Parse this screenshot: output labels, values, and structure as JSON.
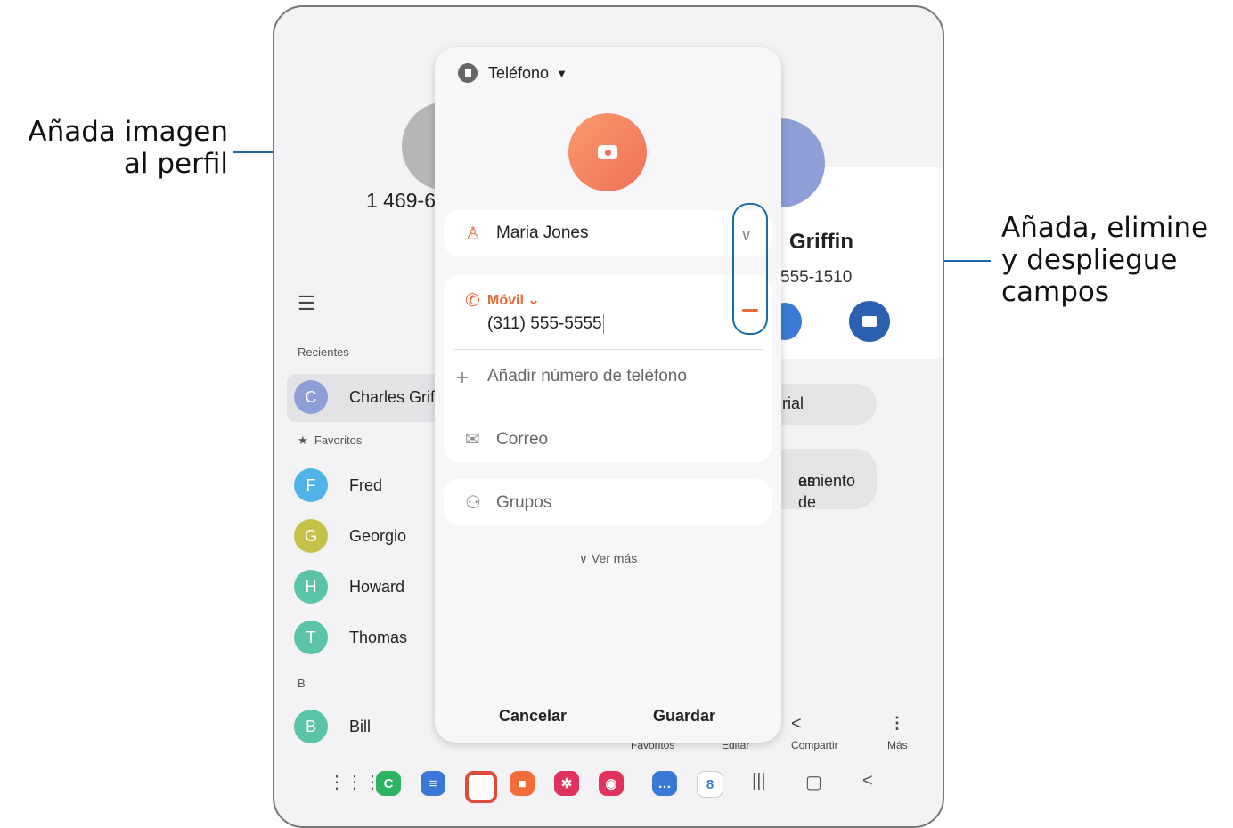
{
  "callouts": {
    "left": [
      "Añada imagen",
      "al perfil"
    ],
    "right": [
      "Añada, elimine",
      "y despliegue",
      "campos"
    ]
  },
  "background": {
    "phone_fragment": "1 469-6",
    "contact_name": "Griffin",
    "contact_number": "555-1510",
    "pill_1": "rial",
    "pill_2_line1": "es de",
    "pill_2_line2": "amiento",
    "menu_icon": "hamburger-icon",
    "recents_title": "Recientes",
    "recent_contact": "Charles Grif",
    "favorites_title": "Favoritos",
    "contacts": [
      {
        "initial": "C",
        "name": "Charles Grif",
        "color": "#8e9ed6"
      },
      {
        "initial": "F",
        "name": "Fred",
        "color": "#4fb3e8"
      },
      {
        "initial": "G",
        "name": "Georgio",
        "color": "#c4c24a"
      },
      {
        "initial": "H",
        "name": "Howard",
        "color": "#5bc4a8"
      },
      {
        "initial": "T",
        "name": "Thomas",
        "color": "#5bc4a8"
      },
      {
        "initial": "B",
        "name": "Bill",
        "color": "#5bc4a8"
      }
    ],
    "section_b": "B",
    "bottom_actions": [
      "Favoritos",
      "Editar",
      "Compartir",
      "Más"
    ]
  },
  "dialog": {
    "storage_label": "Teléfono",
    "name_value": "Maria Jones",
    "phone_type": "Móvil",
    "phone_value": "(311) 555-5555",
    "add_phone": "Añadir número de teléfono",
    "email": "Correo",
    "groups": "Grupos",
    "see_more": "Ver más",
    "cancel": "Cancelar",
    "save": "Guardar"
  },
  "colors": {
    "accent_orange": "#e8683a",
    "callout_blue": "#1a6aa6"
  }
}
